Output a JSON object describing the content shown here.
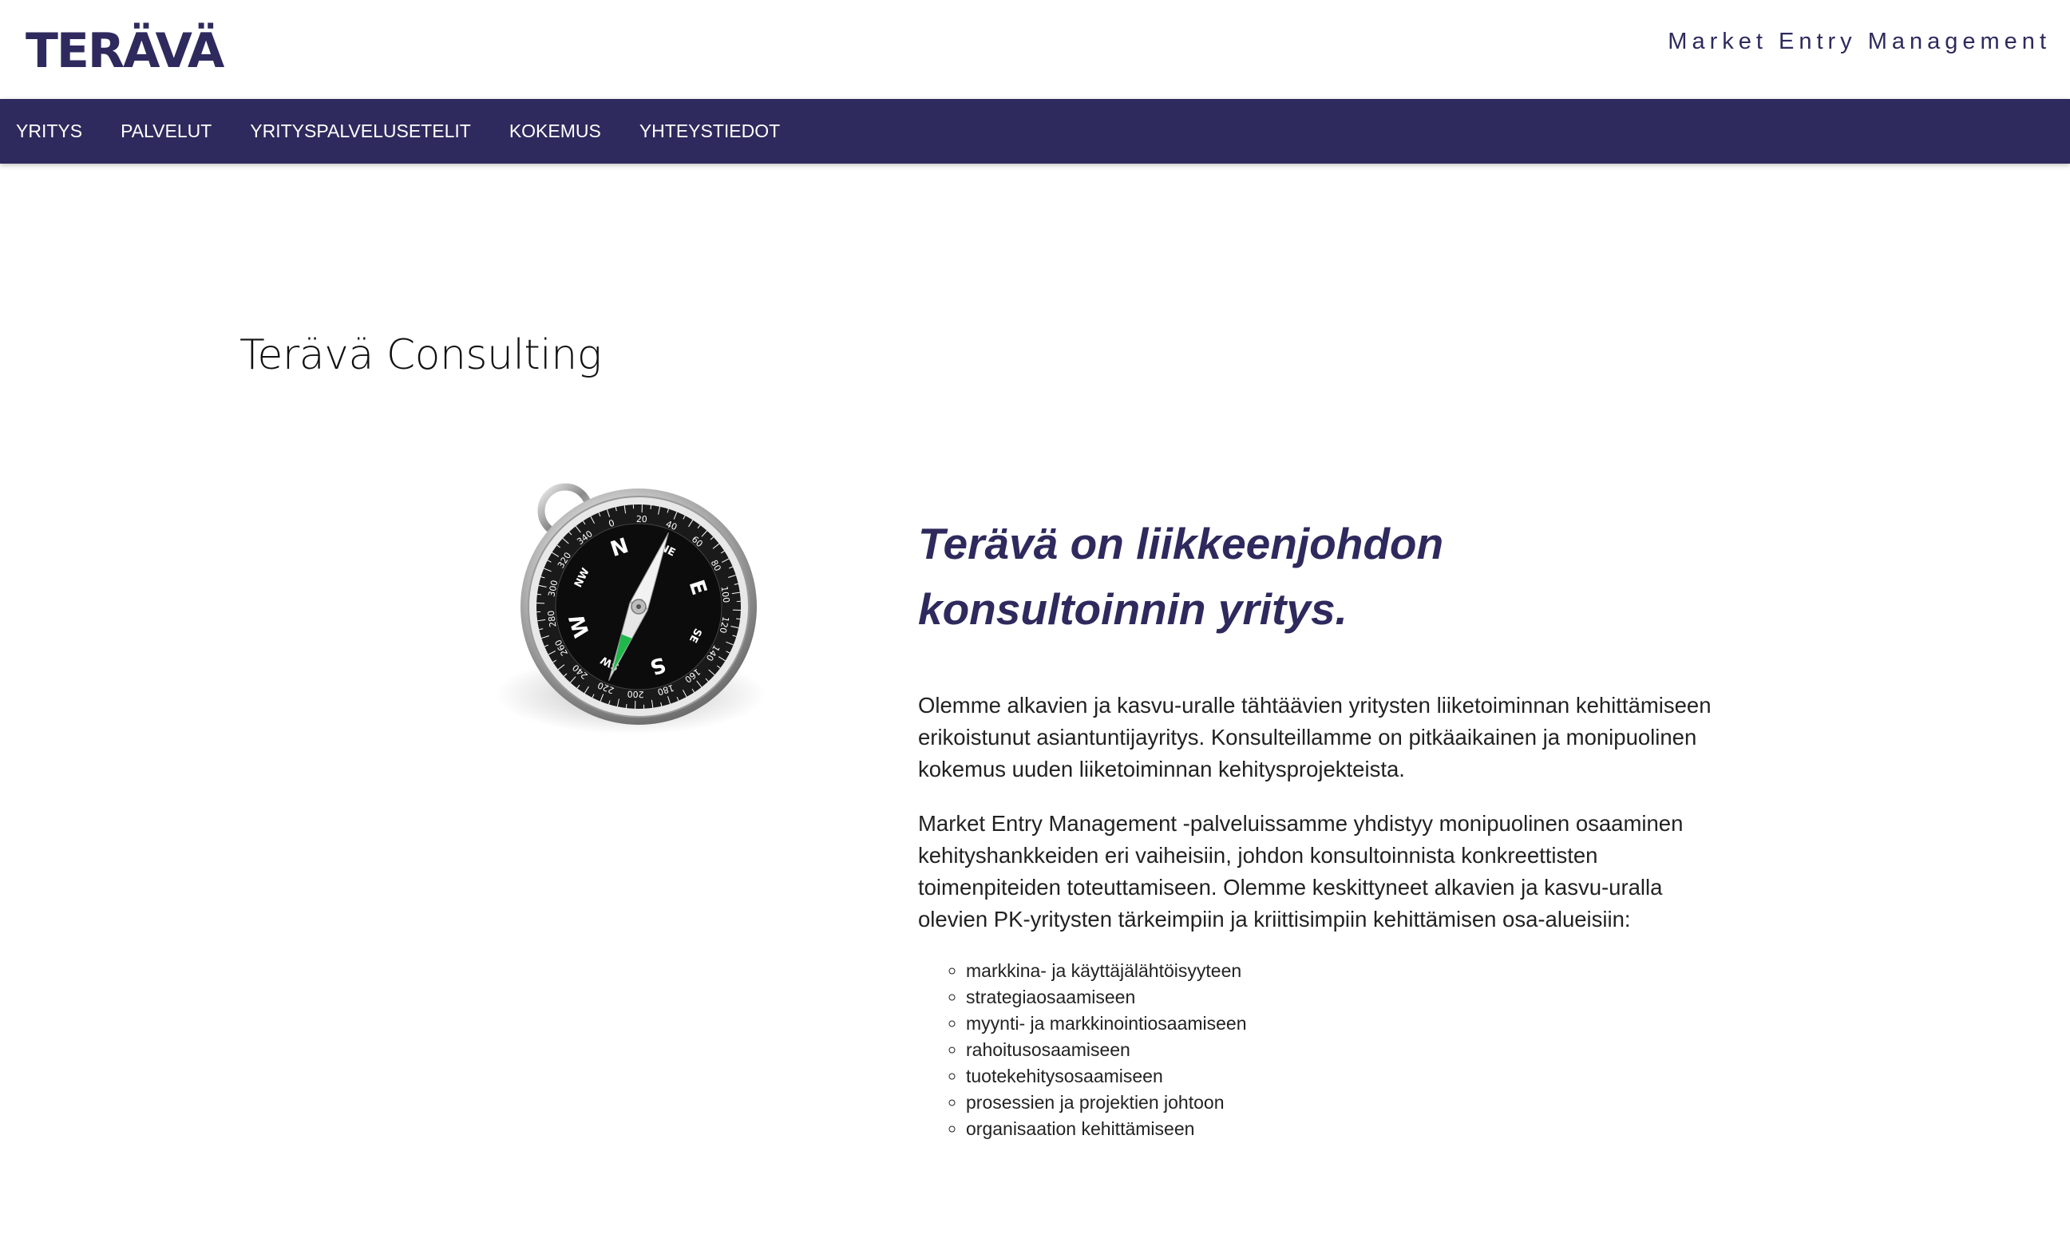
{
  "header": {
    "logo_text": "TERÄVÄ",
    "tagline": "Market Entry Management"
  },
  "nav": {
    "items": [
      {
        "label": "YRITYS"
      },
      {
        "label": "PALVELUT"
      },
      {
        "label": "YRITYSPALVELUSETELIT"
      },
      {
        "label": "KOKEMUS"
      },
      {
        "label": "YHTEYSTIEDOT"
      }
    ]
  },
  "main": {
    "title": "Terävä Consulting",
    "image": "compass-image",
    "lead": "Terävä on liikkeenjohdon konsultoinnin yritys.",
    "paragraphs": [
      "Olemme alkavien ja kasvu-uralle tähtäävien yritysten liiketoiminnan kehittämiseen erikoistunut asiantuntijayritys. Konsulteillamme on pitkäaikainen ja monipuolinen kokemus uuden liiketoiminnan kehitysprojekteista.",
      "Market Entry Management -palveluissamme yhdistyy monipuolinen osaaminen kehityshankkeiden eri vaiheisiin, johdon konsultoinnista konkreettisten toimenpiteiden toteuttamiseen. Olemme keskittyneet alkavien ja kasvu-uralla olevien PK-yritysten tärkeimpiin ja kriittisimpiin kehittämisen osa-alueisiin:"
    ],
    "list": [
      "markkina- ja käyttäjälähtöisyyteen",
      "strategiaosaamiseen",
      "myynti- ja markkinointiosaamiseen",
      "rahoitusosaamiseen",
      "tuotekehitysosaamiseen",
      "prosessien ja projektien johtoon",
      "organisaation kehittämiseen"
    ],
    "compass": {
      "cardinals": [
        "N",
        "E",
        "S",
        "W"
      ],
      "intercardinals": [
        "NE",
        "SE",
        "SW",
        "NW"
      ],
      "degrees": [
        "0",
        "20",
        "40",
        "60",
        "80",
        "100",
        "120",
        "140",
        "160",
        "180",
        "200",
        "220",
        "240",
        "260",
        "280",
        "300",
        "320",
        "340"
      ]
    }
  },
  "colors": {
    "brand": "#2e2a5d",
    "text": "#222222",
    "background": "#ffffff"
  }
}
